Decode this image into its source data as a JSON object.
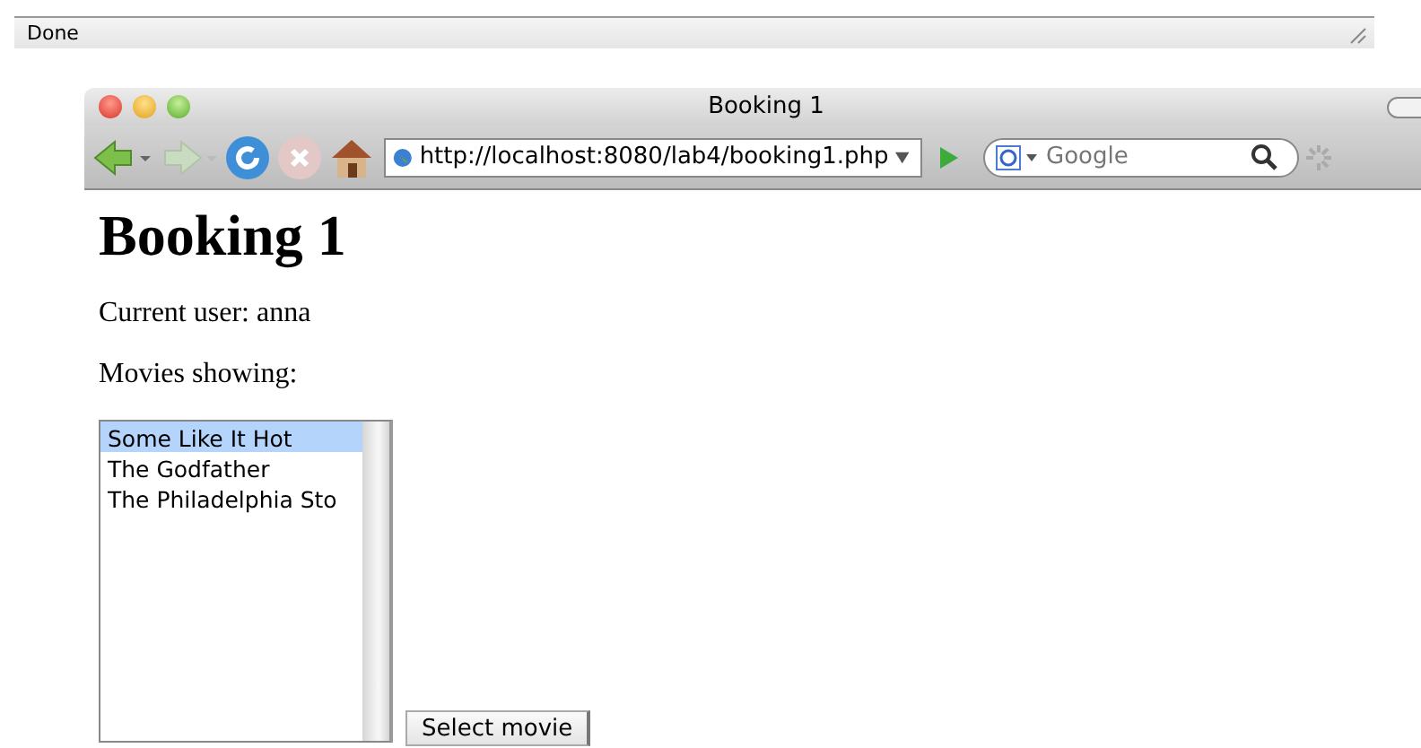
{
  "status_bar": {
    "text": "Done"
  },
  "window": {
    "title": "Booking 1"
  },
  "toolbar": {
    "address": "http://localhost:8080/lab4/booking1.php",
    "search": {
      "placeholder": "Google"
    }
  },
  "page": {
    "heading": "Booking 1",
    "current_user": "Current user: anna",
    "movies_label": "Movies showing:",
    "movies": [
      {
        "label": "Some Like It Hot",
        "selected": true
      },
      {
        "label": "The Godfather",
        "selected": false
      },
      {
        "label": "The Philadelphia Sto",
        "selected": false
      }
    ],
    "button": "Select movie"
  }
}
